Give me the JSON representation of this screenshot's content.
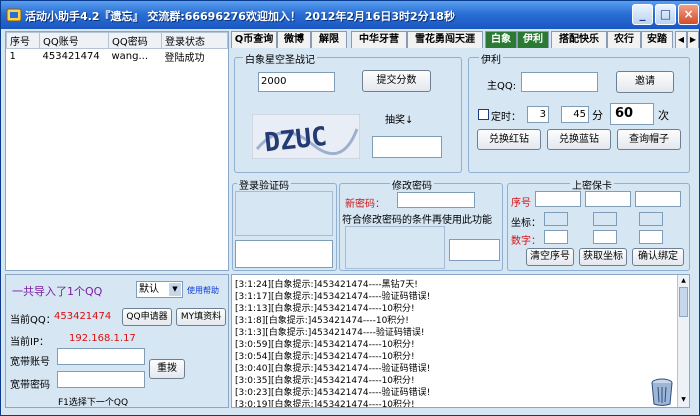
{
  "title": "活动小助手4.2『遗忘』 交流群:66696276欢迎加入！ 2012年2月16日3时2分18秒",
  "window_buttons": {
    "minimize": "_",
    "maximize": "□",
    "close": "×"
  },
  "accounts_table": {
    "headers": [
      "序号",
      "QQ账号",
      "QQ密码",
      "登录状态"
    ],
    "rows": [
      [
        "1",
        "453421474",
        "wang...",
        "登陆成功"
      ]
    ]
  },
  "tabs": [
    "Q币查询",
    "微博",
    "解限",
    "中华牙营",
    "雪花勇闯天涯",
    "白象",
    "伊利",
    "搭配快乐",
    "农行",
    "安踏"
  ],
  "active_tab": "白象",
  "baixiang": {
    "legend": "白象星空圣战记",
    "value": "2000",
    "submit_label": "提交分数",
    "captcha_text": "DZUC",
    "lottery_label": "抽奖↓",
    "lottery_value": ""
  },
  "yili": {
    "legend": "伊利",
    "main_qq_label": "主QQ:",
    "main_qq_value": "",
    "invite_label": "邀请",
    "timer_label": "定时：",
    "hour_value": "3",
    "minute_value": "45",
    "minute_unit": "分",
    "count_value": "60",
    "count_unit": "次",
    "redeem_red": "兑换红钻",
    "redeem_blue": "兑换蓝钻",
    "query_hat": "查询帽子"
  },
  "login_captcha": {
    "legend": "登录验证码"
  },
  "change_pwd": {
    "legend": "修改密码",
    "new_pwd_label": "新密码：",
    "hint": "符合修改密码的条件再使用此功能"
  },
  "secure_card": {
    "legend": "上密保卡",
    "serial_label": "序号",
    "coord_label": "坐标：",
    "digit_label": "数字：",
    "clear_serial": "清空序号",
    "get_coord": "获取坐标",
    "confirm_bind": "确认绑定"
  },
  "left": {
    "imported_text": "一共导入了1个QQ",
    "mode_value": "默认",
    "help_link": "使用帮助",
    "current_qq_label": "当前QQ：",
    "current_qq_value": "453421474",
    "qq_apply_btn": "QQ申请器",
    "my_fill_btn": "MY填资料",
    "current_ip_label": "当前IP：",
    "current_ip_value": "192.168.1.17",
    "broadband_account_label": "宽带账号",
    "broadband_password_label": "宽带密码",
    "redial_btn": "重拨",
    "f1_hint": "F1选择下一个QQ"
  },
  "log_lines": [
    "[3:1:24][白象提示:]453421474----黑钻7天!",
    "[3:1:17][白象提示:]453421474----验证码错误!",
    "[3:1:13][白象提示:]453421474----10积分!",
    "[3:1:8][白象提示:]453421474----10积分!",
    "[3:1:3][白象提示:]453421474----验证码错误!",
    "[3:0:59][白象提示:]453421474----10积分!",
    "[3:0:54][白象提示:]453421474----10积分!",
    "[3:0:40][白象提示:]453421474----验证码错误!",
    "[3:0:35][白象提示:]453421474----10积分!",
    "[3:0:23][白象提示:]453421474----验证码错误!",
    "[3:0:19][白象提示:]453421474----10积分!"
  ],
  "colors": {
    "title_bg": "#1b56c2",
    "active_tab": "#2a7a33",
    "red_text": "#d81010",
    "blue_text": "#0b3ad8"
  }
}
